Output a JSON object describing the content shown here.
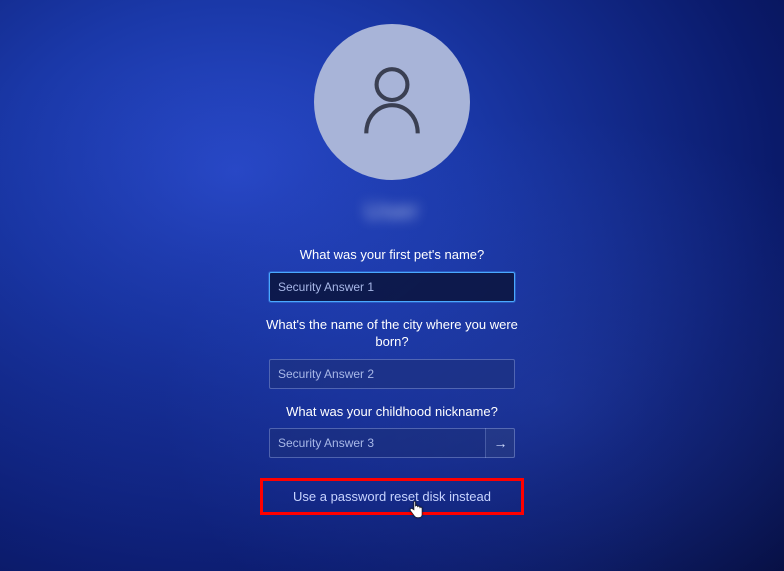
{
  "avatar": {
    "icon": "user-icon"
  },
  "username": "User",
  "questions": [
    {
      "text": "What was your first pet's name?",
      "placeholder": "Security Answer 1"
    },
    {
      "text": "What's the name of the city where you were born?",
      "placeholder": "Security Answer 2"
    },
    {
      "text": "What was your childhood nickname?",
      "placeholder": "Security Answer 3"
    }
  ],
  "reset_link": "Use a password reset disk instead",
  "highlight_color": "#ff0000"
}
